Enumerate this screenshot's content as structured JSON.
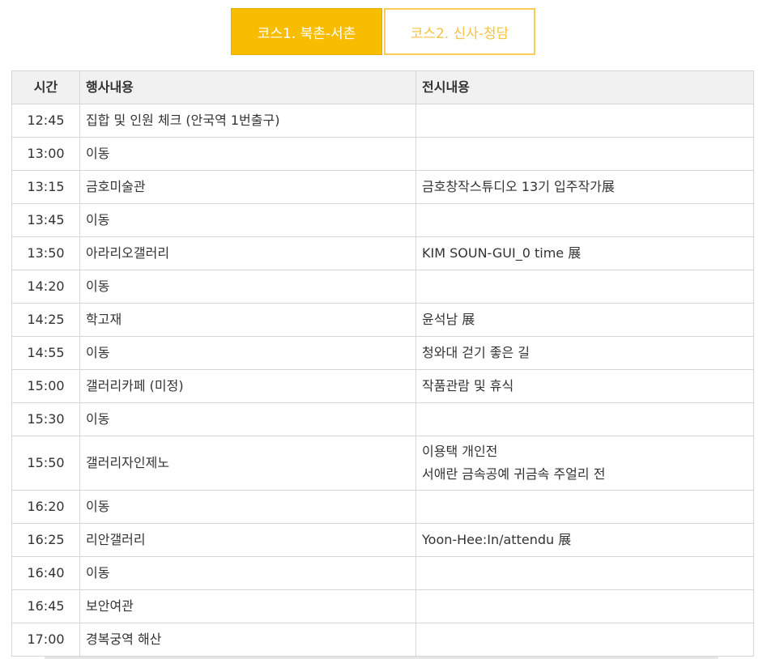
{
  "tabs": [
    {
      "label": "코스1. 북촌-서촌",
      "active": true
    },
    {
      "label": "코스2. 신사-청담",
      "active": false
    }
  ],
  "table": {
    "headers": {
      "time": "시간",
      "event": "행사내용",
      "exhibition": "전시내용"
    },
    "rows": [
      {
        "time": "12:45",
        "event": "집합 및 인원 체크 (안국역 1번출구)",
        "exhibition": ""
      },
      {
        "time": "13:00",
        "event": "이동",
        "exhibition": ""
      },
      {
        "time": "13:15",
        "event": "금호미술관",
        "exhibition": "금호창작스튜디오 13기 입주작가展"
      },
      {
        "time": "13:45",
        "event": "이동",
        "exhibition": ""
      },
      {
        "time": "13:50",
        "event": "아라리오갤러리",
        "exhibition": "KIM SOUN-GUI_0 time 展"
      },
      {
        "time": "14:20",
        "event": "이동",
        "exhibition": ""
      },
      {
        "time": "14:25",
        "event": "학고재",
        "exhibition": "윤석남 展"
      },
      {
        "time": "14:55",
        "event": "이동",
        "exhibition": "청와대 걷기 좋은 길"
      },
      {
        "time": "15:00",
        "event": "갤러리카페 (미정)",
        "exhibition": "작품관람 및 휴식"
      },
      {
        "time": "15:30",
        "event": "이동",
        "exhibition": ""
      },
      {
        "time": "15:50",
        "event": "갤러리자인제노",
        "exhibition": "이용택 개인전",
        "exhibition2": "서애란 금속공예 귀금속 주얼리 전"
      },
      {
        "time": "16:20",
        "event": "이동",
        "exhibition": ""
      },
      {
        "time": "16:25",
        "event": "리안갤러리",
        "exhibition": "Yoon-Hee:In/attendu 展"
      },
      {
        "time": "16:40",
        "event": "이동",
        "exhibition": ""
      },
      {
        "time": "16:45",
        "event": "보안여관",
        "exhibition": ""
      },
      {
        "time": "17:00",
        "event": "경복궁역 해산",
        "exhibition": ""
      }
    ]
  },
  "colors": {
    "accent": "#f9bd00",
    "inactive_border": "#f9cd55",
    "header_bg": "#f1f1f1",
    "grid": "#d6d6d6"
  }
}
